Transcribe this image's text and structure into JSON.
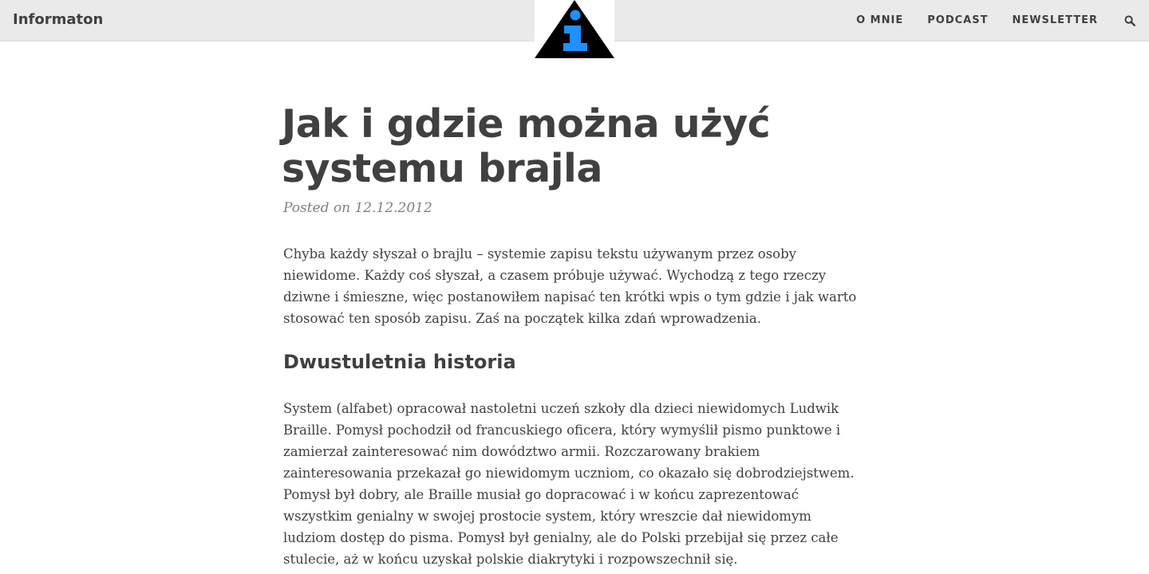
{
  "header": {
    "brand": "Informaton",
    "nav": [
      {
        "label": "O MNIE"
      },
      {
        "label": "PODCAST"
      },
      {
        "label": "NEWSLETTER"
      }
    ],
    "search_icon": "search-icon",
    "logo_icon": "info-triangle-logo",
    "logo_colors": {
      "triangle": "#000000",
      "letter": "#1e90ff"
    }
  },
  "post": {
    "title": "Jak i gdzie można użyć systemu brajla",
    "meta": "Posted on 12.12.2012",
    "intro": "Chyba każdy słyszał o brajlu – systemie zapisu tekstu używanym przez osoby niewidome. Każdy coś słyszał, a czasem próbuje używać. Wychodzą z tego rzeczy dziwne i śmieszne, więc postanowiłem napisać ten krótki wpis o tym gdzie i jak warto stosować ten sposób zapisu. Zaś na początek kilka zdań wprowadzenia.",
    "section_heading": "Dwustuletnia historia",
    "section_text": "System (alfabet) opracował nastoletni uczeń szkoły dla dzieci niewidomych Ludwik Braille. Pomysł pochodził od francuskiego oficera, który wymyślił pismo punktowe i zamierzał zainteresować nim dowództwo armii. Rozczarowany brakiem zainteresowania przekazał go niewidomym uczniom, co okazało się dobrodziejstwem. Pomysł był dobry, ale Braille musiał go dopracować i w końcu zaprezentować wszystkim genialny w swojej prostocie system, który wreszcie dał niewidomym ludziom dostęp do pisma. Pomysł był genialny, ale do Polski przebijał się przez całe stulecie, aż w końcu uzyskał polskie diakrytyki i rozpowszechnił się."
  }
}
